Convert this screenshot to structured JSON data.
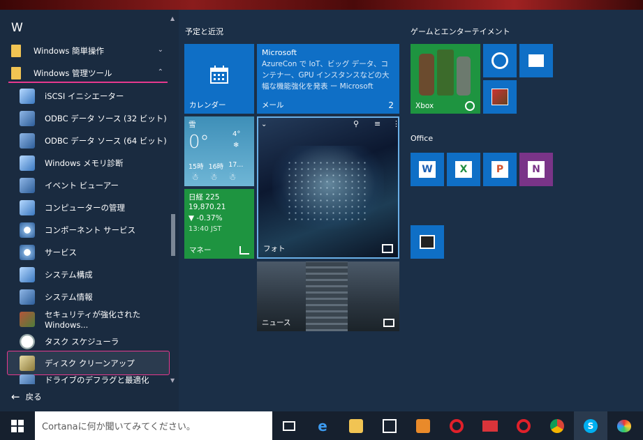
{
  "list": {
    "letter": "W",
    "groups": [
      {
        "label": "Windows 簡単操作"
      },
      {
        "label": "Windows 管理ツール"
      }
    ],
    "items": [
      {
        "label": "iSCSI イニシエーター"
      },
      {
        "label": "ODBC データ ソース (32 ビット)"
      },
      {
        "label": "ODBC データ ソース (64 ビット)"
      },
      {
        "label": "Windows メモリ診断"
      },
      {
        "label": "イベント ビューアー"
      },
      {
        "label": "コンピューターの管理"
      },
      {
        "label": "コンポーネント サービス"
      },
      {
        "label": "サービス"
      },
      {
        "label": "システム構成"
      },
      {
        "label": "システム情報"
      },
      {
        "label": "セキュリティが強化された Windows..."
      },
      {
        "label": "タスク スケジューラ"
      },
      {
        "label": "ディスク クリーンアップ"
      },
      {
        "label": "ドライブのデフラグと最適化"
      }
    ],
    "back": "戻る"
  },
  "groups": {
    "plans": "予定と近況",
    "games": "ゲームとエンターテイメント",
    "office": "Office"
  },
  "tiles": {
    "calendar": "カレンダー",
    "mail_sender": "Microsoft",
    "mail_body": "AzureCon で IoT、ビッグ データ、コンテナー、GPU インスタンスなどの大幅な機能強化を発表 ー Microsoft",
    "mail_label": "メール",
    "mail_count": "2",
    "weather_cond": "雪",
    "weather_temp": "0°",
    "weather_small": "4°",
    "weather_h1": "15時",
    "weather_h2": "16時",
    "weather_h3": "17...",
    "finance_name": "日経 225",
    "finance_value": "19,870.21",
    "finance_change": "▼ -0.37%",
    "finance_time": "13:40 JST",
    "finance_label": "マネー",
    "photo_label": "フォト",
    "news_label": "ニュース",
    "xbox_label": "Xbox"
  },
  "taskbar": {
    "search_placeholder": "Cortanaに何か聞いてみてください。"
  },
  "colors": {
    "accent": "#e7398e",
    "tile_blue": "#0f6fc6",
    "tile_green": "#1e9440",
    "start_bg": "#1b2f47"
  }
}
